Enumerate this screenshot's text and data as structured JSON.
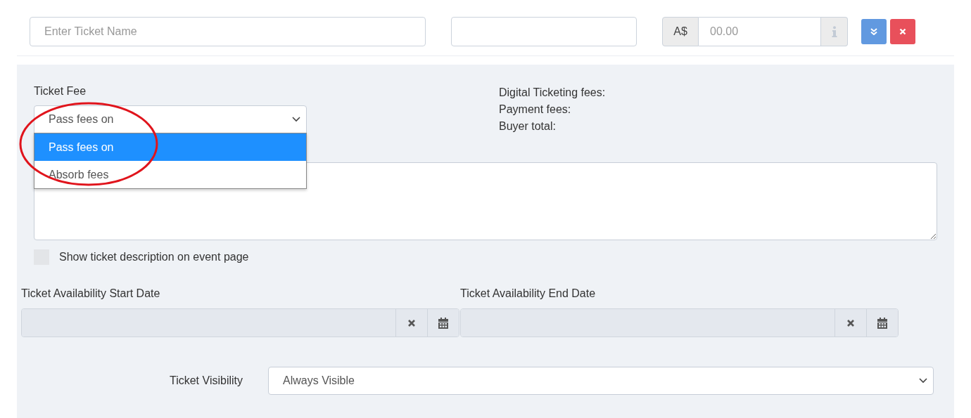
{
  "ticket_row": {
    "name_field": {
      "placeholder": "Enter Ticket Name"
    },
    "price_field": {
      "currency": "A$",
      "placeholder": "00.00"
    },
    "buttons": [
      {
        "kind": "expand"
      },
      {
        "kind": "remove"
      }
    ]
  },
  "ticket_fee": {
    "label": "Ticket Fee",
    "value": "Pass fees on",
    "expanded": true,
    "options": [
      {
        "label": "Pass fees on",
        "selected": true
      },
      {
        "label": "Absorb fees",
        "selected": false
      }
    ]
  },
  "fee_summary": [
    "Digital Ticketing fees:",
    "Payment fees:",
    "Buyer total:"
  ],
  "show_description": {
    "label": "Show ticket description on event page",
    "checked": false
  },
  "date_fields": [
    {
      "label": "Ticket Availability Start Date"
    },
    {
      "label": "Ticket Availability End Date"
    }
  ],
  "visibility": {
    "label": "Ticket Visibility",
    "value": "Always Visible"
  },
  "annotations": [
    {
      "kind": "ellipse"
    }
  ]
}
